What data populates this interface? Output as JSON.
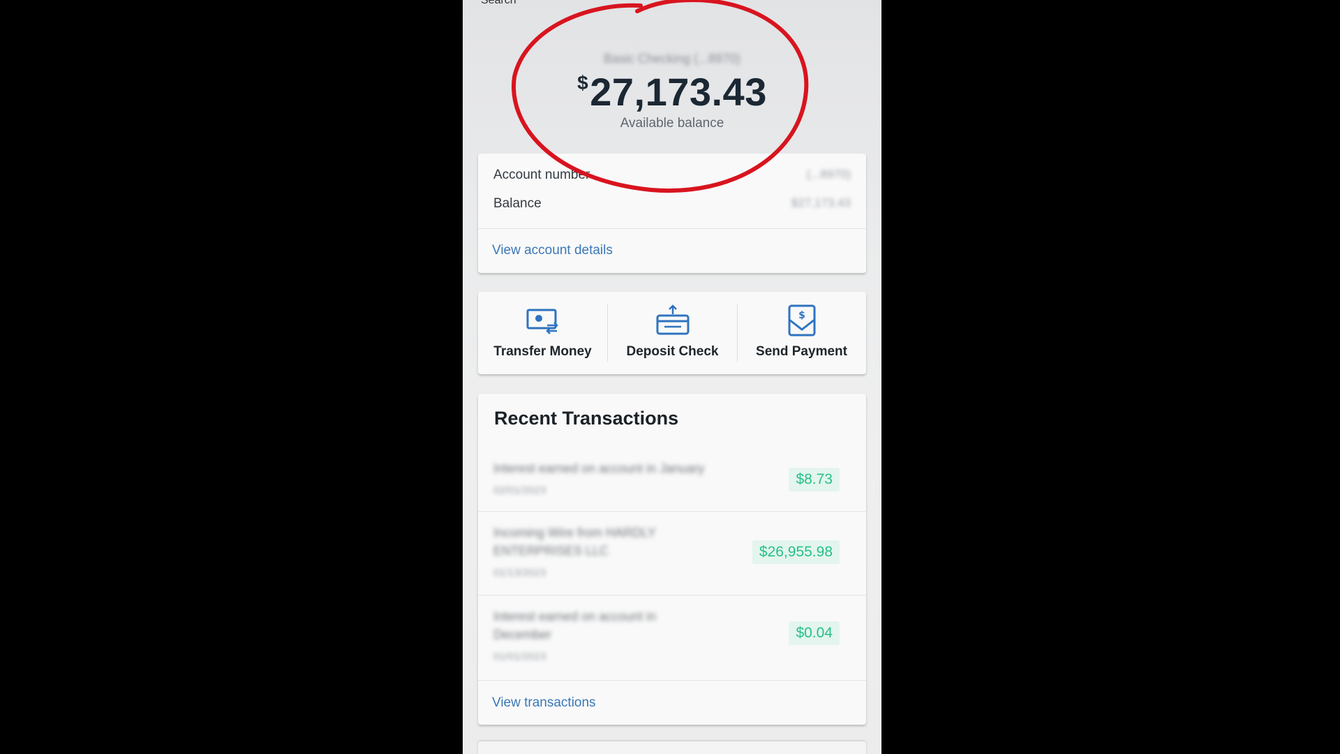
{
  "header": {
    "search_hint": "Search",
    "account_name": "Basic Checking (...8970)",
    "currency_symbol": "$",
    "balance": "27,173.43",
    "balance_caption": "Available balance"
  },
  "account_card": {
    "rows": [
      {
        "label": "Account number",
        "value": "(...8970)"
      },
      {
        "label": "Balance",
        "value": "$27,173.43"
      }
    ],
    "link": "View account details"
  },
  "actions": [
    {
      "label": "Transfer Money",
      "icon": "transfer-money-icon"
    },
    {
      "label": "Deposit Check",
      "icon": "deposit-check-icon"
    },
    {
      "label": "Send Payment",
      "icon": "send-payment-icon"
    }
  ],
  "transactions": {
    "title": "Recent Transactions",
    "items": [
      {
        "description": "Interest earned on account in January",
        "date": "02/01/2023",
        "amount": "$8.73"
      },
      {
        "description": "Incoming Wire from HARDLY ENTERPRISES LLC",
        "date": "01/13/2023",
        "amount": "$26,955.98"
      },
      {
        "description": "Interest earned on account in December",
        "date": "01/01/2023",
        "amount": "$0.04"
      }
    ],
    "link": "View transactions"
  },
  "colors": {
    "annotation_circle": "#d8141f",
    "link": "#3a78b8",
    "icon_blue": "#2f73c0",
    "positive_amount": "#27c187",
    "positive_amount_bg": "#e3f5ee"
  }
}
